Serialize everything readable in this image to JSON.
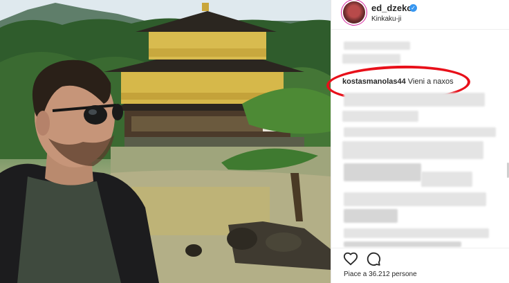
{
  "post": {
    "username": "ed_dzeko",
    "location": "Kinkaku-ji",
    "verified_icon": "verified-badge-icon"
  },
  "highlighted_comment": {
    "author": "kostasmanolas44",
    "text": "Vieni a naxos"
  },
  "footer": {
    "likes_text": "Piace a 36.212 persone",
    "like_icon": "heart-icon",
    "comment_icon": "comment-bubble-icon"
  },
  "colors": {
    "highlight": "#e8101a",
    "verified": "#3897f0",
    "text": "#262626"
  }
}
